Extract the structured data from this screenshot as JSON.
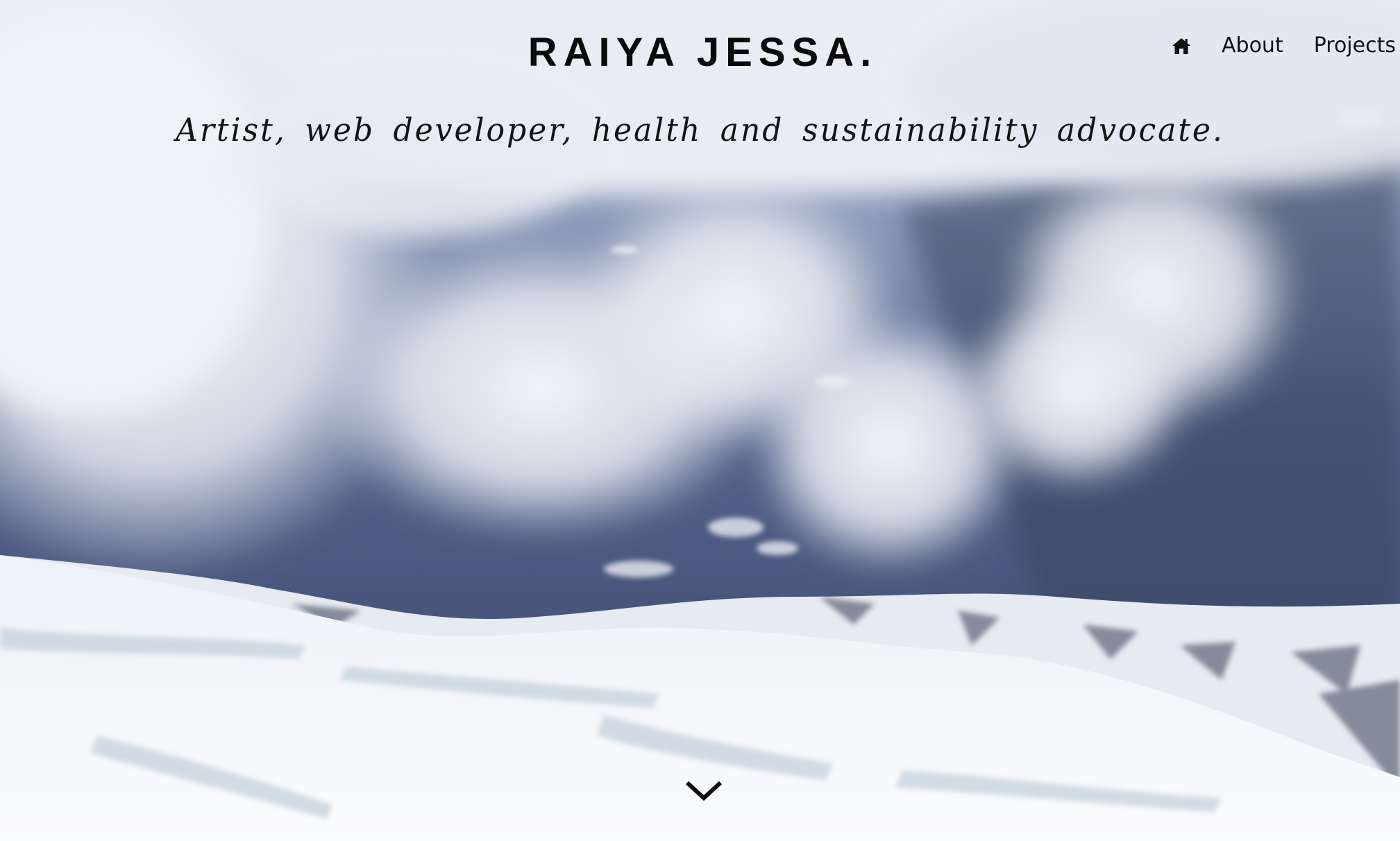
{
  "header": {
    "title": "RAIYA JESSA.",
    "tagline": "Artist, web developer, health and sustainability advocate."
  },
  "nav": {
    "home_icon": "home-icon",
    "items": [
      {
        "label": "About"
      },
      {
        "label": "Projects"
      }
    ]
  },
  "hero": {
    "scroll_icon": "chevron-down-icon"
  },
  "colors": {
    "text": "#0b0b0b",
    "sky_mid": "#4f5f86",
    "cloud": "#e9edf3",
    "snow": "#f4f6f9"
  }
}
